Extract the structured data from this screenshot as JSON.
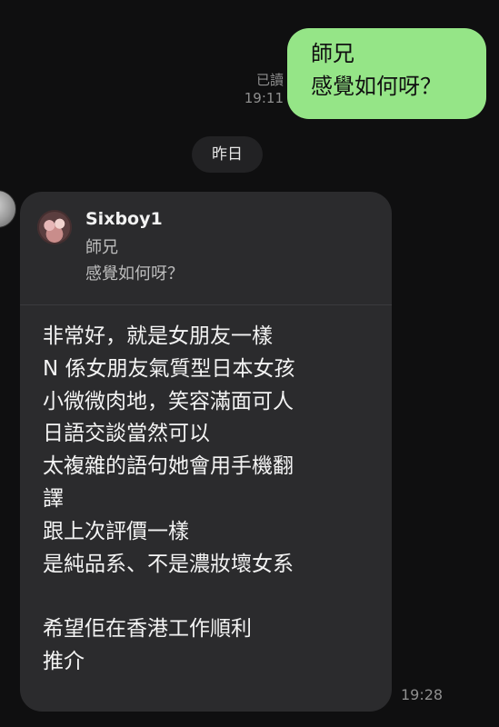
{
  "outgoing_message": {
    "status": "已讀",
    "time": "19:11",
    "lines": [
      "師兄",
      "感覺如何呀？"
    ],
    "bubble_color": "#95e587"
  },
  "date_separator": "昨日",
  "incoming_message": {
    "time": "19:28",
    "bubble_color": "#2b2b2d",
    "quoted": {
      "sender_name": "Sixboy1",
      "lines": [
        "師兄",
        "感覺如何呀？"
      ]
    },
    "lines": [
      "非常好，就是女朋友一樣",
      "N 係女朋友氣質型日本女孩",
      "小微微肉地，笑容滿面可人",
      "日語交談當然可以",
      "太複雜的語句她會用手機翻",
      "譯",
      "跟上次評價一樣",
      "是純品系、不是濃妝壞女系",
      "",
      "希望佢在香港工作順利",
      "推介"
    ]
  }
}
